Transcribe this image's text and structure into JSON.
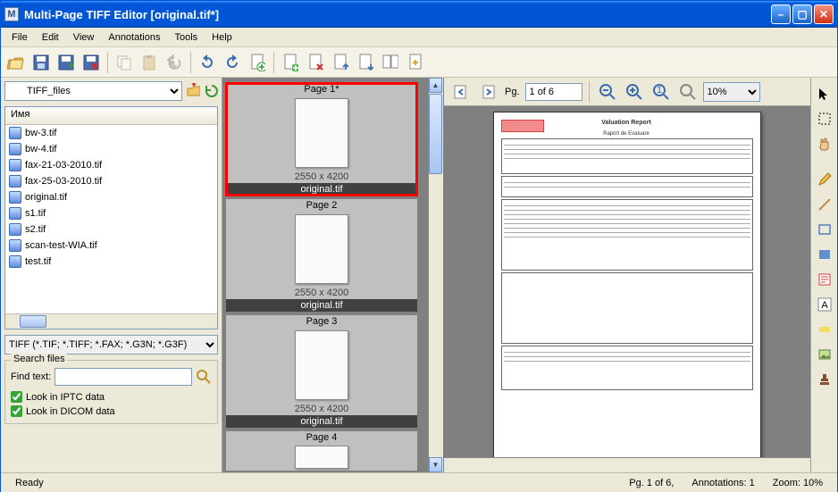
{
  "window": {
    "title": "Multi-Page TIFF Editor [original.tif*]"
  },
  "menu": [
    "File",
    "Edit",
    "View",
    "Annotations",
    "Tools",
    "Help"
  ],
  "folder_dropdown": "TIFF_files",
  "file_list": {
    "header": "Имя",
    "items": [
      "bw-3.tif",
      "bw-4.tif",
      "fax-21-03-2010.tif",
      "fax-25-03-2010.tif",
      "original.tif",
      "s1.tif",
      "s2.tif",
      "scan-test-WIA.tif",
      "test.tif"
    ]
  },
  "filter_dropdown": "TIFF (*.TIF; *.TIFF; *.FAX; *.G3N; *.G3F)",
  "search": {
    "legend": "Search files",
    "find_label": "Find text:",
    "find_value": "",
    "chk_iptc": "Look in IPTC data",
    "chk_dicom": "Look in DICOM data"
  },
  "thumbnails": [
    {
      "title": "Page 1*",
      "dim": "2550 x 4200",
      "file": "original.tif",
      "selected": true
    },
    {
      "title": "Page 2",
      "dim": "2550 x 4200",
      "file": "original.tif",
      "selected": false
    },
    {
      "title": "Page 3",
      "dim": "2550 x 4200",
      "file": "original.tif",
      "selected": false
    },
    {
      "title": "Page 4",
      "dim": "",
      "file": "",
      "selected": false
    }
  ],
  "preview": {
    "page_label_prefix": "Pg.",
    "page_value": "1 of 6",
    "zoom_value": "10%",
    "doc_title": "Valuation Report",
    "doc_subtitle": "Raport de Evaluare"
  },
  "status": {
    "ready": "Ready",
    "page": "Pg. 1 of 6,",
    "annotations": "Annotations: 1",
    "zoom": "Zoom: 10%"
  }
}
